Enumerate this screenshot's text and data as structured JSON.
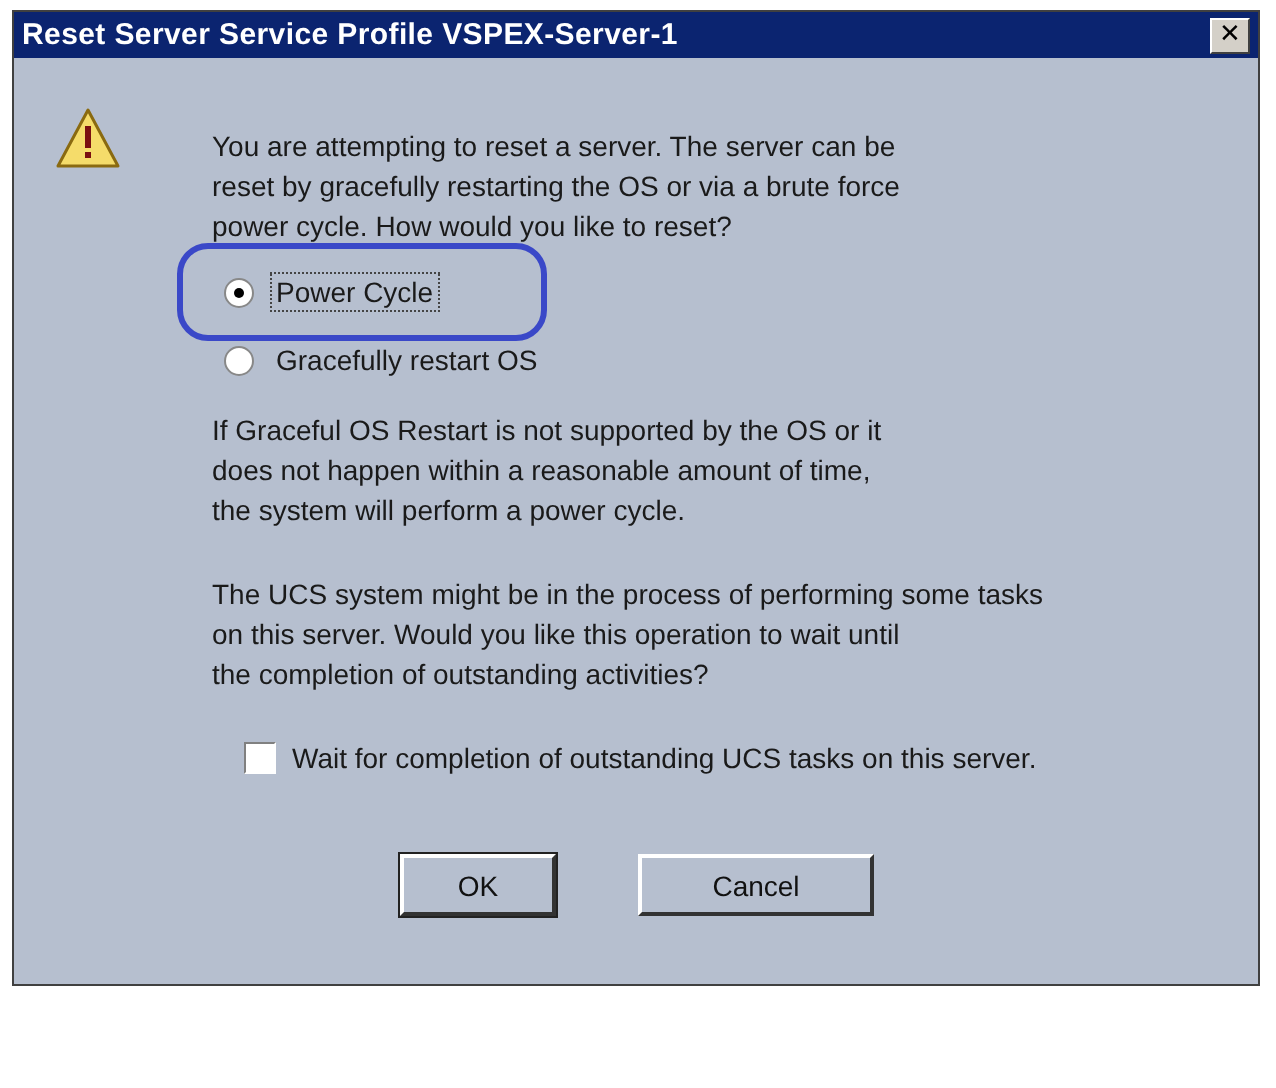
{
  "window": {
    "title": "Reset Server Service Profile VSPEX-Server-1",
    "close": "✕"
  },
  "message": [
    "You are attempting to reset a server. The server can be",
    "reset by gracefully restarting the OS or via a brute force",
    "power cycle. How would you like to reset?"
  ],
  "options": [
    {
      "label": "Power Cycle",
      "selected": true,
      "highlighted": true
    },
    {
      "label": "Gracefully restart OS",
      "selected": false,
      "highlighted": false
    }
  ],
  "note": [
    "If Graceful OS Restart is not supported by the OS or it",
    "does not happen within a reasonable amount of time,",
    "the system will perform a power cycle."
  ],
  "question": [
    "The UCS system might be in the process of performing some tasks",
    "on this server. Would you like this operation to wait until",
    "the completion of outstanding activities?"
  ],
  "wait_checkbox": {
    "label": "Wait for completion of outstanding UCS tasks on this server.",
    "checked": false
  },
  "buttons": [
    "OK",
    "Cancel"
  ]
}
